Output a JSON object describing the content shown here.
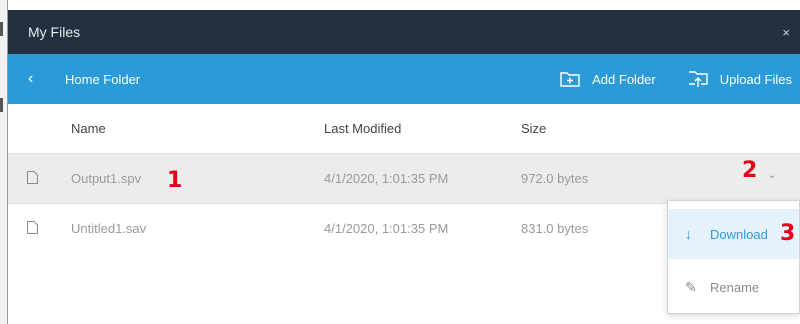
{
  "window": {
    "title": "My Files",
    "close_symbol": "×"
  },
  "nav": {
    "back_symbol": "‹",
    "breadcrumb": "Home Folder",
    "add_folder_label": "Add Folder",
    "upload_files_label": "Upload Files"
  },
  "table": {
    "columns": {
      "name": "Name",
      "modified": "Last Modified",
      "size": "Size"
    },
    "rows": [
      {
        "name": "Output1.spv",
        "modified": "4/1/2020, 1:01:35 PM",
        "size": "972.0 bytes",
        "selected": true
      },
      {
        "name": "Untitled1.sav",
        "modified": "4/1/2020, 1:01:35 PM",
        "size": "831.0 bytes",
        "selected": false
      }
    ],
    "row_menu_symbol": "⌄"
  },
  "context_menu": {
    "items": [
      {
        "label": "Download",
        "icon": "download-arrow-icon",
        "glyph": "↓"
      },
      {
        "label": "Rename",
        "icon": "pencil-icon",
        "glyph": "✎"
      }
    ]
  },
  "annotations": [
    "1",
    "2",
    "3"
  ],
  "colors": {
    "titlebar": "#232f3e",
    "navbar": "#2b9bd8",
    "annotation": "#e3001b",
    "selected_row": "#ececec",
    "menu_highlight": "#e6f2fb"
  }
}
